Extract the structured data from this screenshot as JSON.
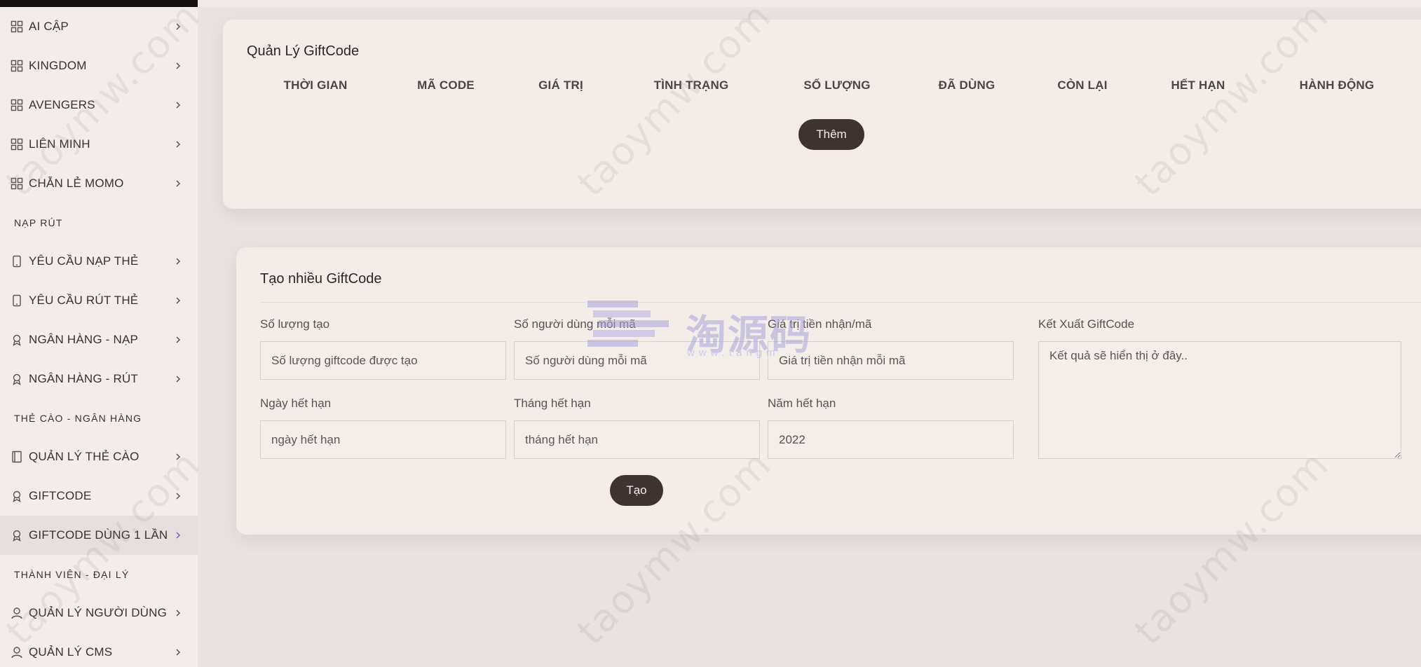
{
  "sidebar": {
    "items": [
      {
        "label": "AI CẬP",
        "icon": "grid-icon"
      },
      {
        "label": "KINGDOM",
        "icon": "grid-icon"
      },
      {
        "label": "AVENGERS",
        "icon": "grid-icon"
      },
      {
        "label": "LIÊN MINH",
        "icon": "grid-icon"
      },
      {
        "label": "CHẴN LẺ MOMO",
        "icon": "grid-icon"
      }
    ],
    "section_naprut": "NẠP RÚT",
    "items2": [
      {
        "label": "YÊU CẦU NẠP THẺ",
        "icon": "phone-icon"
      },
      {
        "label": "YÊU CẦU RÚT THẺ",
        "icon": "phone-icon"
      },
      {
        "label": "NGÂN HÀNG - NẠP",
        "icon": "award-icon"
      },
      {
        "label": "NGÂN HÀNG - RÚT",
        "icon": "award-icon"
      }
    ],
    "section_thecao": "THẺ CÀO - NGÂN HÀNG",
    "items3": [
      {
        "label": "QUẢN LÝ THẺ CÀO",
        "icon": "book-icon"
      },
      {
        "label": "GIFTCODE",
        "icon": "award-icon"
      },
      {
        "label": "GIFTCODE DÙNG 1 LẦN",
        "icon": "award-icon",
        "active": true
      }
    ],
    "section_thanhvien": "THÀNH VIÊN - ĐẠI LÝ",
    "items4": [
      {
        "label": "QUẢN LÝ NGƯỜI DÙNG",
        "icon": "user-icon"
      },
      {
        "label": "QUẢN LÝ CMS",
        "icon": "user-icon"
      }
    ]
  },
  "manage": {
    "title": "Quản Lý GiftCode",
    "columns": [
      "THỜI GIAN",
      "MÃ CODE",
      "GIÁ TRỊ",
      "TÌNH TRẠNG",
      "SỐ LƯỢNG",
      "ĐÃ DÙNG",
      "CÒN LẠI",
      "HẾT HẠN",
      "HÀNH ĐỘNG"
    ],
    "add_button": "Thêm"
  },
  "create": {
    "title": "Tạo nhiều GiftCode",
    "quantity_label": "Số lượng tạo",
    "quantity_placeholder": "Số lượng giftcode được tạo",
    "users_label": "Số người dùng mỗi mã",
    "users_placeholder": "Số người dùng mỗi mã",
    "value_label": "Giá trị tiền nhận/mã",
    "value_placeholder": "Giá trị tiền nhận mỗi mã",
    "day_label": "Ngày hết hạn",
    "day_placeholder": "ngày hết hạn",
    "month_label": "Tháng hết hạn",
    "month_placeholder": "tháng hết hạn",
    "year_label": "Năm hết hạn",
    "year_value": "2022",
    "export_label": "Kết Xuất GiftCode",
    "export_placeholder": "Kết quả sẽ hiển thị ở đây..",
    "create_button": "Tạo"
  },
  "watermark": {
    "text": "taoymw.com",
    "logo_cn": "淘源码",
    "logo_url": "www.tangm"
  }
}
